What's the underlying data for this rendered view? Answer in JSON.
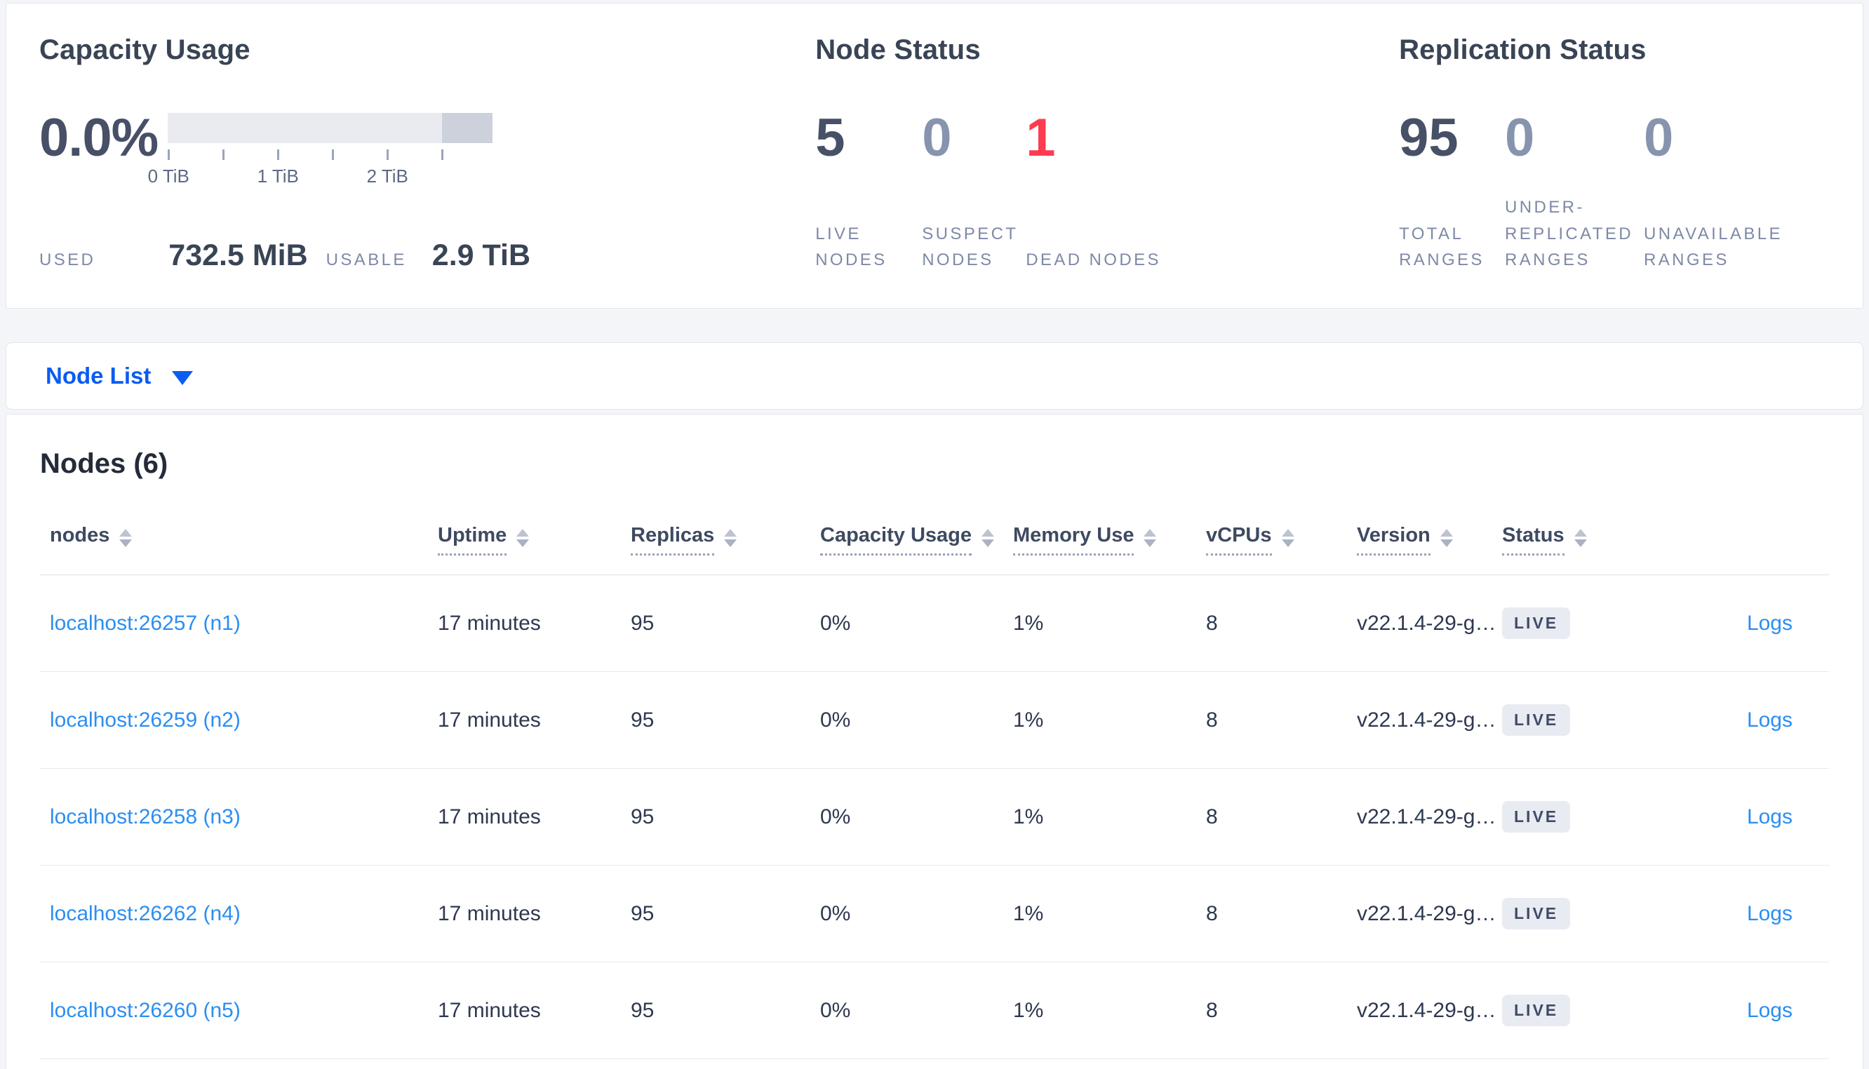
{
  "colors": {
    "accent_blue": "#0b5cf0",
    "link_blue": "#2b8ef2",
    "dead_red": "#ff3b4f",
    "dark_number": "#475066",
    "light_number": "#8794ae",
    "muted_label": "#7e89a6",
    "badge_bg": "#e8ebf1",
    "capacity_bar_light": "#e9ebf1",
    "capacity_bar_dark": "#cdd1db"
  },
  "summary": {
    "capacity": {
      "title": "Capacity Usage",
      "percent": "0.0%",
      "tick_labels": [
        "0 TiB",
        "1 TiB",
        "2 TiB"
      ],
      "used_label": "USED",
      "used_value": "732.5 MiB",
      "usable_label": "USABLE",
      "usable_value": "2.9 TiB"
    },
    "node_status": {
      "title": "Node Status",
      "stats": [
        {
          "value": "5",
          "label": "LIVE NODES"
        },
        {
          "value": "0",
          "label": "SUSPECT NODES"
        },
        {
          "value": "1",
          "label": "DEAD NODES"
        }
      ]
    },
    "replication": {
      "title": "Replication Status",
      "stats": [
        {
          "value": "95",
          "label": "TOTAL RANGES"
        },
        {
          "value": "0",
          "label": "UNDER-REPLICATED RANGES"
        },
        {
          "value": "0",
          "label": "UNAVAILABLE RANGES"
        }
      ]
    }
  },
  "view_selector": {
    "label": "Node List"
  },
  "nodes_section": {
    "heading": "Nodes (6)",
    "columns": [
      "nodes",
      "Uptime",
      "Replicas",
      "Capacity Usage",
      "Memory Use",
      "vCPUs",
      "Version",
      "Status"
    ],
    "rows": [
      {
        "address": "localhost:26257 (n1)",
        "uptime": "17 minutes",
        "replicas": "95",
        "capacity_usage": "0%",
        "memory_use": "1%",
        "vcpus": "8",
        "version": "v22.1.4-29-g…",
        "status": "LIVE",
        "logs_label": "Logs"
      },
      {
        "address": "localhost:26259 (n2)",
        "uptime": "17 minutes",
        "replicas": "95",
        "capacity_usage": "0%",
        "memory_use": "1%",
        "vcpus": "8",
        "version": "v22.1.4-29-g…",
        "status": "LIVE",
        "logs_label": "Logs"
      },
      {
        "address": "localhost:26258 (n3)",
        "uptime": "17 minutes",
        "replicas": "95",
        "capacity_usage": "0%",
        "memory_use": "1%",
        "vcpus": "8",
        "version": "v22.1.4-29-g…",
        "status": "LIVE",
        "logs_label": "Logs"
      },
      {
        "address": "localhost:26262 (n4)",
        "uptime": "17 minutes",
        "replicas": "95",
        "capacity_usage": "0%",
        "memory_use": "1%",
        "vcpus": "8",
        "version": "v22.1.4-29-g…",
        "status": "LIVE",
        "logs_label": "Logs"
      },
      {
        "address": "localhost:26260 (n5)",
        "uptime": "17 minutes",
        "replicas": "95",
        "capacity_usage": "0%",
        "memory_use": "1%",
        "vcpus": "8",
        "version": "v22.1.4-29-g…",
        "status": "LIVE",
        "logs_label": "Logs"
      }
    ]
  }
}
